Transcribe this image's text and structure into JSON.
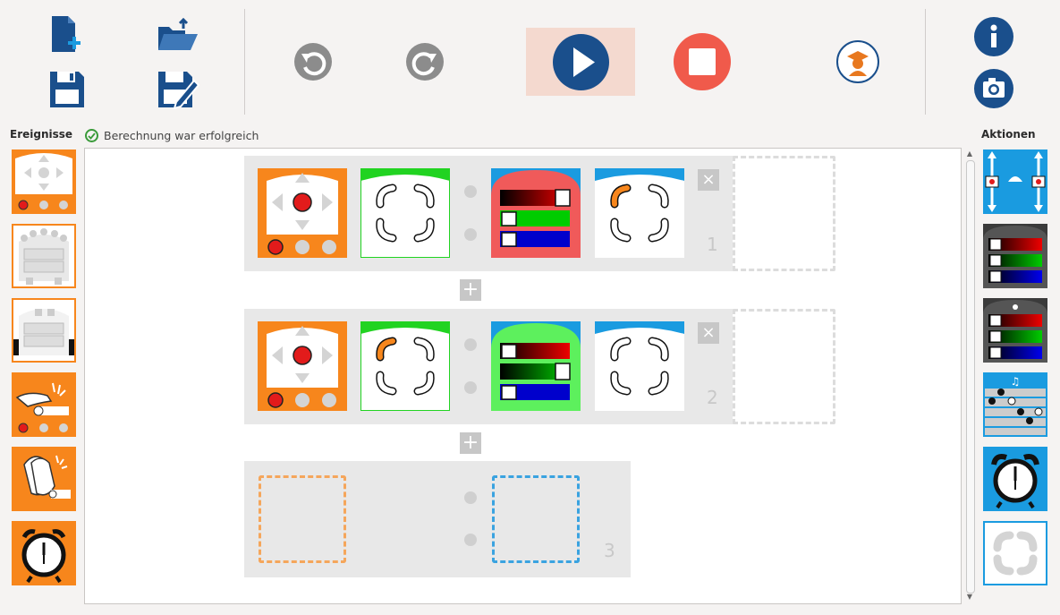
{
  "toolbar": {
    "buttons": [
      "new-file",
      "open-file",
      "save-file",
      "save-as-file",
      "undo",
      "redo",
      "run",
      "stop",
      "teacher-mode",
      "info",
      "screenshot"
    ],
    "colors": {
      "navy": "#1a4f8c",
      "gray": "#8c8c8c",
      "stop": "#f05a4b",
      "teacher": "#e8781f",
      "play_bg": "#f4d9cf"
    }
  },
  "left_panel": {
    "title": "Ereignisse"
  },
  "right_panel": {
    "title": "Aktionen"
  },
  "status": {
    "text": "Berechnung war erfolgreich",
    "icon": "check-circle-icon"
  },
  "rows": [
    {
      "number": "1"
    },
    {
      "number": "2"
    },
    {
      "number": "3"
    }
  ],
  "add_button_label": "+",
  "remove_button_label": "×"
}
